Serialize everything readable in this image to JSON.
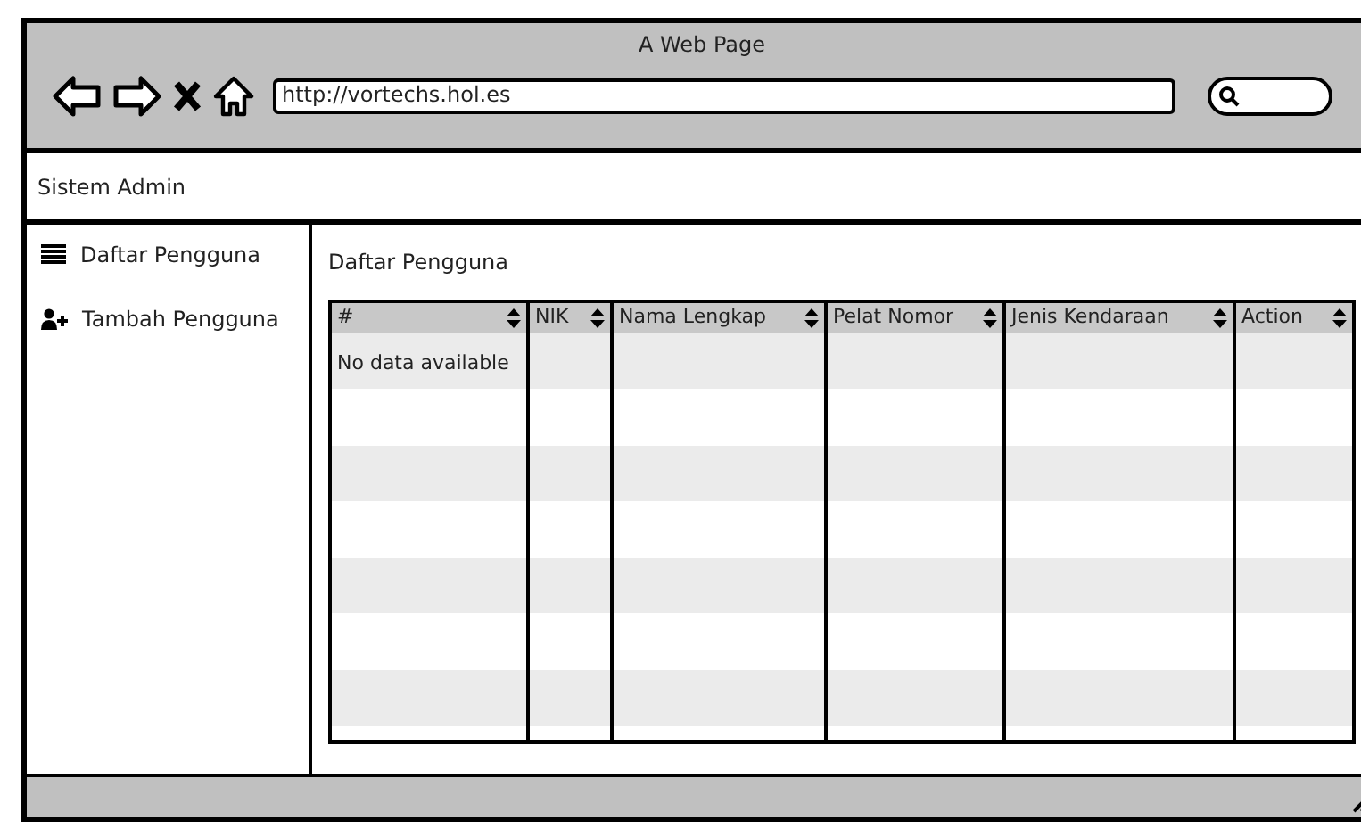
{
  "window": {
    "title": "A Web Page"
  },
  "browser": {
    "url": "http://vortechs.hol.es"
  },
  "navbar": {
    "brand": "Sistem Admin"
  },
  "sidebar": {
    "items": [
      {
        "label": "Daftar Pengguna",
        "kind": "list"
      },
      {
        "label": "Tambah Pengguna",
        "kind": "add-user"
      }
    ]
  },
  "content": {
    "heading": "Daftar Pengguna",
    "table": {
      "columns": [
        "#",
        "NIK",
        "Nama Lengkap",
        "Pelat Nomor",
        "Jenis Kendaraan",
        "Action"
      ],
      "empty_message": "No data available"
    }
  }
}
